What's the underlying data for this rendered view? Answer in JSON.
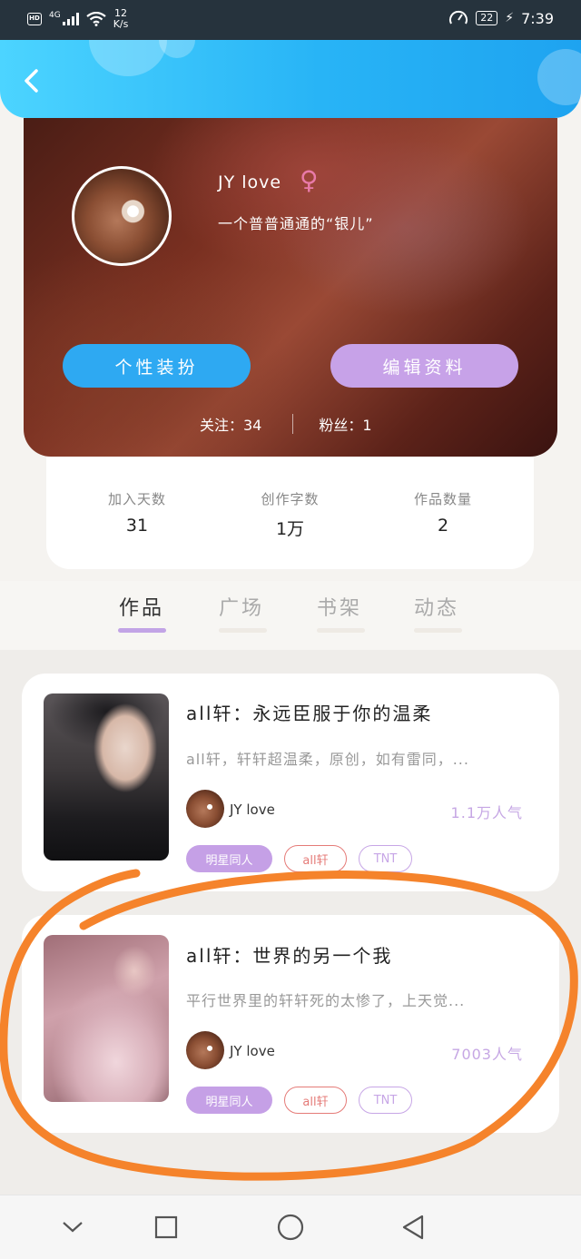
{
  "status_bar": {
    "hd": "HD",
    "network": "4G",
    "speed_value": "12",
    "speed_unit": "K/s",
    "battery": "22",
    "time": "7:39"
  },
  "header": {
    "back_icon": "chevron-left-icon"
  },
  "profile": {
    "username": "JY love",
    "gender_symbol": "♀",
    "bio": "一个普普通通的“银儿”",
    "dress_button": "个性装扮",
    "edit_button": "编辑资料",
    "following": "关注：34",
    "fans": "粉丝：1"
  },
  "stats": [
    {
      "label": "加入天数",
      "value": "31"
    },
    {
      "label": "创作字数",
      "value": "1万"
    },
    {
      "label": "作品数量",
      "value": "2"
    }
  ],
  "tabs": [
    {
      "label": "作品",
      "active": true
    },
    {
      "label": "广场",
      "active": false
    },
    {
      "label": "书架",
      "active": false
    },
    {
      "label": "动态",
      "active": false
    }
  ],
  "works": [
    {
      "title": "all轩：永远臣服于你的温柔",
      "desc": "all轩，轩轩超温柔，原创，如有雷同，...",
      "author": "JY love",
      "popularity": "1.1万人气",
      "tags": [
        "明星同人",
        "all轩",
        "TNT"
      ]
    },
    {
      "title": "all轩：世界的另一个我",
      "desc": "平行世界里的轩轩死的太惨了，上天觉...",
      "author": "JY love",
      "popularity": "7003人气",
      "tags": [
        "明星同人",
        "all轩",
        "TNT"
      ]
    }
  ],
  "colors": {
    "header_blue": "#28b4f6",
    "accent_purple": "#c2a4e6",
    "button_blue": "#2ea9f2",
    "annotation_orange": "#f5832b"
  }
}
